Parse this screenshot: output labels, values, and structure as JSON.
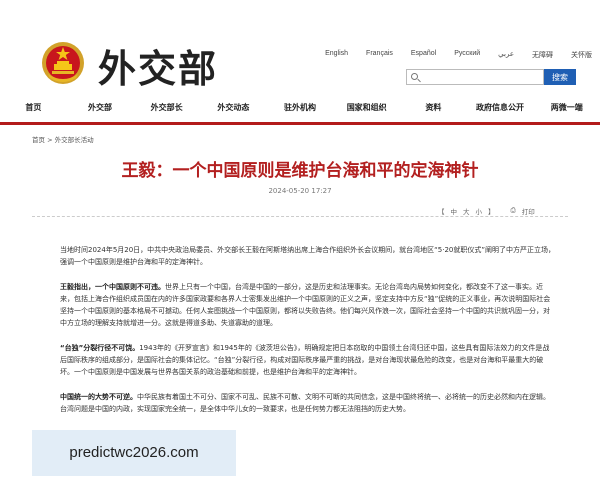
{
  "header": {
    "logo_text": "外交部",
    "languages": [
      "English",
      "Français",
      "Español",
      "Русский",
      "عربي",
      "无障碍",
      "关怀版"
    ],
    "search": {
      "placeholder": "",
      "button_label": "搜索"
    }
  },
  "nav": [
    {
      "label": "首页"
    },
    {
      "label": "外交部"
    },
    {
      "label": "外交部长"
    },
    {
      "label": "外交动态"
    },
    {
      "label": "驻外机构"
    },
    {
      "label": "国家和组织"
    },
    {
      "label": "资料"
    },
    {
      "label": "政府信息公开"
    },
    {
      "label": "两微一端"
    }
  ],
  "breadcrumb": {
    "home": "首页",
    "sep": " > ",
    "section": "外交部长活动"
  },
  "article": {
    "title": "王毅：一个中国原则是维护台海和平的定海神针",
    "date": "2024-05-20 17:27",
    "tools": {
      "open": "【",
      "large": "中",
      "mid": "大",
      "small": "小",
      "close": "】",
      "print": "打印"
    },
    "p1": "当地时间2024年5月20日，中共中央政治局委员、外交部长王毅在阿斯塔纳出席上海合作组织外长会议期间，就台湾地区“5·20就职仪式”阐明了中方严正立场，强调一个中国原则是维护台海和平的定海神针。",
    "p2_lead": "王毅指出，一个中国原则不可违。",
    "p2": "世界上只有一个中国，台湾是中国的一部分，这是历史和法理事实。无论台湾岛内局势如何变化，都改变不了这一事实。近来，包括上海合作组织成员国在内的许多国家政要和各界人士密集发出维护一个中国原则的正义之声，坚定支持中方反“独”促统的正义事业，再次说明国际社会坚持一个中国原则的基本格局不可撼动。任何人妄图挑战一个中国原则，都将以失败告终。他们每兴风作浪一次，国际社会坚持一个中国的共识就巩固一分，对中方立场的理解支持就增进一分。这就是得道多助、失道寡助的道理。",
    "p3_lead": "“台独”分裂行径不可饶。",
    "p3": "1943年的《开罗宣言》和1945年的《波茨坦公告》，明确规定把日本窃取的中国领土台湾归还中国，这些具有国际法效力的文件是战后国际秩序的组成部分，是国际社会的集体记忆。“台独”分裂行径，构成对国际秩序最严重的挑战，是对台海现状最危险的改变，也是对台海和平最重大的破坏。一个中国原则是中国发展与世界各国关系的政治基础和前提，也是维护台海和平的定海神针。",
    "p4_lead": "中国统一的大势不可逆。",
    "p4": "中华民族有着国土不可分、国家不可乱、民族不可散、文明不可断的共同信念，这是中国终将统一、必将统一的历史必然和内在逻辑。台湾问题是中国的内政，实现国家完全统一，是全体中华儿女的一致要求，也是任何势力都无法阻挡的历史大势。"
  },
  "watermark": "predictwc2026.com",
  "colors": {
    "accent_red": "#b31b1b",
    "title_red": "#b32020",
    "search_blue": "#1f5fb4"
  }
}
